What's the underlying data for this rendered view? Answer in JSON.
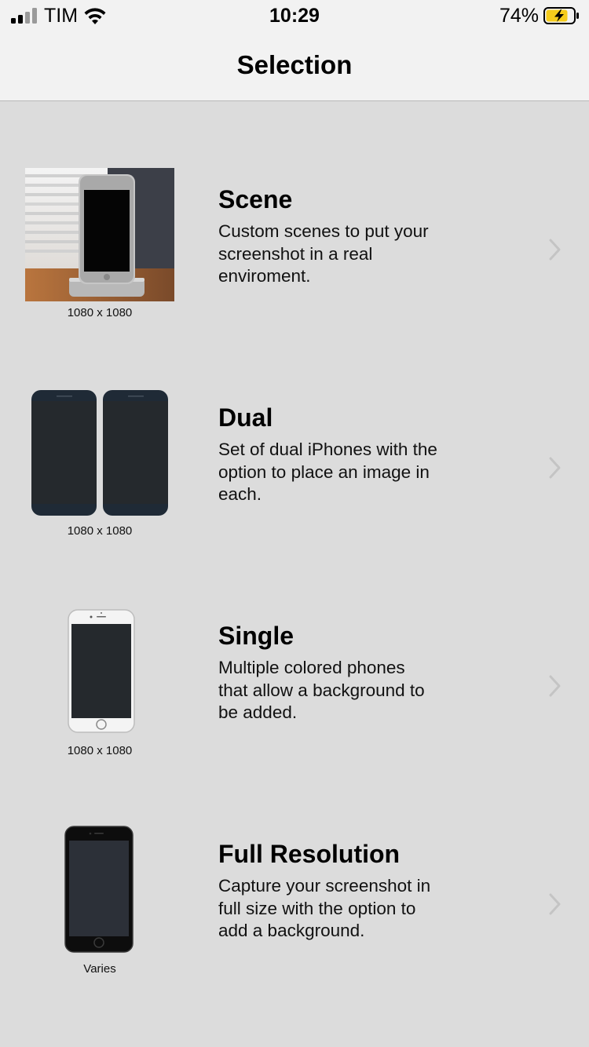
{
  "status_bar": {
    "carrier": "TIM",
    "time": "10:29",
    "battery_percent": "74%"
  },
  "nav": {
    "title": "Selection"
  },
  "items": [
    {
      "title": "Scene",
      "description_lines": [
        "Custom scenes to put your",
        "screenshot in a real",
        "enviroment."
      ],
      "size": "1080 x 1080",
      "thumbnail_icon": "scene-photo-icon"
    },
    {
      "title": "Dual",
      "description_lines": [
        "Set of dual iPhones with the",
        "option to place an image in",
        "each."
      ],
      "size": "1080 x 1080",
      "thumbnail_icon": "dual-phone-icon"
    },
    {
      "title": "Single",
      "description_lines": [
        "Multiple colored phones",
        "that allow a background to",
        "be added."
      ],
      "size": "1080 x 1080",
      "thumbnail_icon": "single-phone-icon"
    },
    {
      "title": "Full Resolution",
      "description_lines": [
        "Capture your screenshot in",
        "full size with the option to",
        "add a background."
      ],
      "size": "Varies",
      "thumbnail_icon": "full-resolution-phone-icon"
    }
  ],
  "colors": {
    "background": "#dcdcdc",
    "bar": "#f2f2f2",
    "battery_fill": "#f5cc1c",
    "chevron": "#c4c4c4",
    "phone_screen": "#24282c"
  }
}
